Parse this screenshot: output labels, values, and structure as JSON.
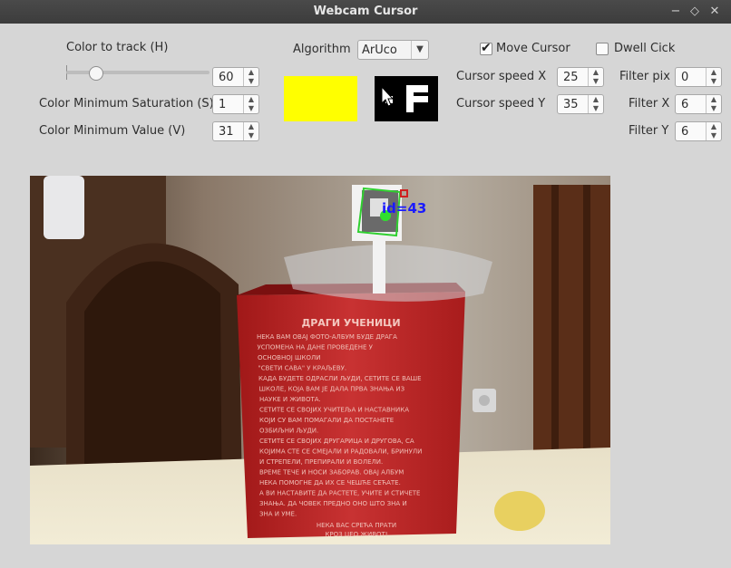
{
  "window": {
    "title": "Webcam Cursor"
  },
  "controls": {
    "color_to_track_label": "Color to track (H)",
    "color_to_track_value": "60",
    "min_saturation_label": "Color Minimum Saturation (S)",
    "min_saturation_value": "1",
    "min_value_label": "Color Minimum Value (V)",
    "min_value_value": "31",
    "algorithm_label": "Algorithm",
    "algorithm_value": "ArUco",
    "move_cursor_label": "Move Cursor",
    "move_cursor_checked": true,
    "dwell_click_label": "Dwell Cick",
    "dwell_click_checked": false,
    "cursor_speed_x_label": "Cursor speed X",
    "cursor_speed_x_value": "25",
    "cursor_speed_y_label": "Cursor speed Y",
    "cursor_speed_y_value": "35",
    "filter_pix_label": "Filter pix",
    "filter_pix_value": "0",
    "filter_x_label": "Filter X",
    "filter_x_value": "6",
    "filter_y_label": "Filter Y",
    "filter_y_value": "6",
    "color_swatch": "#ffff00",
    "slider_level_fraction": 0.2
  },
  "camera": {
    "marker_label": "id=43",
    "box_title": "ДРАГИ УЧЕНИЦИ",
    "box_lines": [
      "НЕКА ВАМ ОВАЈ ФОТО-АЛБУМ БУДЕ ДРАГА",
      "УСПОМЕНА НА ДАНЕ ПРОВЕДЕНЕ У",
      "ОСНОВНОЈ ШКОЛИ",
      "\"СВЕТИ САВА\" У КРАЉЕВУ.",
      "КАДА БУДЕТЕ ОДРАСЛИ ЉУДИ, СЕТИТЕ СЕ ВАШЕ",
      "ШКОЛЕ, КОЈА ВАМ ЈЕ ДАЛА ПРВА ЗНАЊА ИЗ",
      "НАУКЕ И ЖИВОТА.",
      "СЕТИТЕ СЕ СВОЈИХ УЧИТЕЉА И НАСТАВНИКА",
      "КОЈИ СУ ВАМ ПОМАГАЛИ ДА ПОСТАНЕТЕ",
      "ОЗБИЉНИ ЉУДИ.",
      "СЕТИТЕ СЕ СВОЈИХ ДРУГАРИЦА И ДРУГОВА, СА",
      "КОЈИМА СТЕ СЕ СМЕЈАЛИ И РАДОВАЛИ, БРИНУЛИ",
      "И СТРЕПЕЛИ, ПРЕПИРАЛИ И ВОЛЕЛИ.",
      "ВРЕМЕ ТЕЧЕ И НОСИ ЗАБОРАВ. ОВАЈ АЛБУМ",
      "НЕКА ПОМОГНЕ ДА ИХ СЕ ЧЕШЋЕ СЕЋАТЕ.",
      "А ВИ НАСТАВИТЕ ДА РАСТЕТЕ, УЧИТЕ И СТИЧЕТЕ",
      "ЗНАЊА. ДА ЧОВЕК ПРЕДНО ОНО ШТО ЗНА И",
      "ЗНА И УМЕ."
    ],
    "box_footer_1": "НЕКА ВАС СРЕЋА ПРАТИ",
    "box_footer_2": "КРОЗ ЦЕО ЖИВОТ!"
  }
}
